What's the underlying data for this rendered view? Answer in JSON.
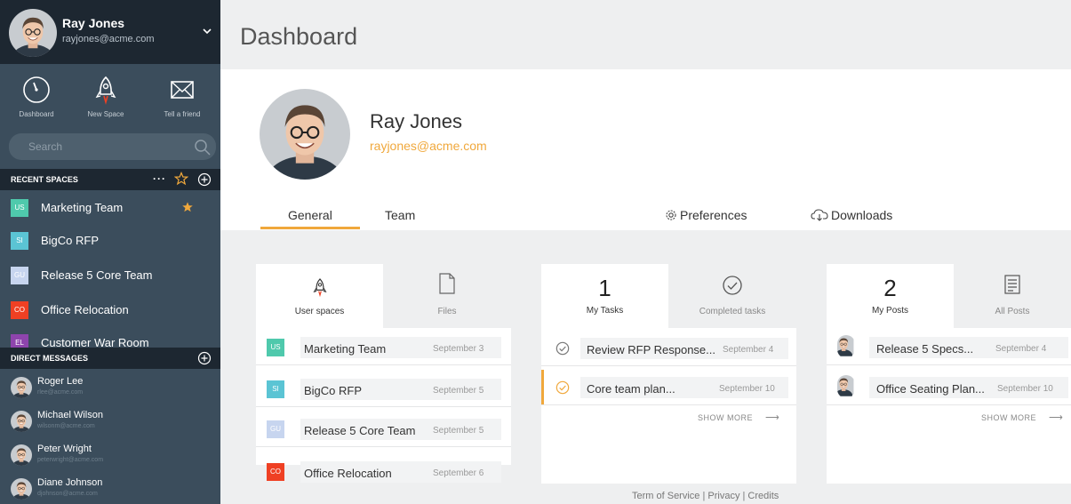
{
  "user": {
    "name": "Ray Jones",
    "email": "rayjones@acme.com"
  },
  "quick_actions": [
    {
      "label": "Dashboard",
      "icon": "dashboard-icon"
    },
    {
      "label": "New Space",
      "icon": "rocket-icon"
    },
    {
      "label": "Tell a friend",
      "icon": "envelope-icon"
    }
  ],
  "search": {
    "placeholder": "Search"
  },
  "recent_spaces": {
    "heading": "RECENT SPACES",
    "more": "···",
    "items": [
      {
        "badge": "US",
        "name": "Marketing Team",
        "color": "#4fc9ac",
        "starred": true
      },
      {
        "badge": "SI",
        "name": "BigCo RFP",
        "color": "#5bc4d4",
        "starred": false
      },
      {
        "badge": "GU",
        "name": "Release 5 Core Team",
        "color": "#c7d5ef",
        "starred": false
      },
      {
        "badge": "CO",
        "name": "Office Relocation",
        "color": "#ef4023",
        "starred": false
      },
      {
        "badge": "EL",
        "name": "Customer War Room",
        "color": "#8e44ad",
        "starred": false
      }
    ]
  },
  "direct_messages": {
    "heading": "DIRECT MESSAGES",
    "items": [
      {
        "name": "Roger Lee",
        "email": "rlee@acme.com"
      },
      {
        "name": "Michael Wilson",
        "email": "wilsonm@acme.com"
      },
      {
        "name": "Peter Wright",
        "email": "peterwright@acme.com"
      },
      {
        "name": "Diane Johnson",
        "email": "djohnson@acme.com"
      }
    ]
  },
  "page": {
    "title": "Dashboard"
  },
  "tabs": {
    "general": "General",
    "team": "Team",
    "preferences": "Preferences",
    "downloads": "Downloads"
  },
  "cards": {
    "spaces": {
      "tab_active": "User spaces",
      "tab_inactive": "Files",
      "items": [
        {
          "badge": "US",
          "name": "Marketing Team",
          "date": "September 3",
          "color": "#4fc9ac"
        },
        {
          "badge": "SI",
          "name": "BigCo RFP",
          "date": "September 5",
          "color": "#5bc4d4"
        },
        {
          "badge": "GU",
          "name": "Release 5 Core Team",
          "date": "September 5",
          "color": "#c7d5ef"
        },
        {
          "badge": "CO",
          "name": "Office Relocation",
          "date": "September 6",
          "color": "#ef4023"
        }
      ]
    },
    "tasks": {
      "count": "1",
      "tab_active": "My Tasks",
      "tab_inactive": "Completed tasks",
      "items": [
        {
          "name": "Review RFP Response...",
          "date": "September 4",
          "highlight": false
        },
        {
          "name": "Core team plan...",
          "date": "September 10",
          "highlight": true
        }
      ],
      "show_more": "SHOW MORE",
      "arrow": "⟶"
    },
    "posts": {
      "count": "2",
      "tab_active": "My Posts",
      "tab_inactive": "All Posts",
      "items": [
        {
          "name": "Release 5 Specs...",
          "date": "September 4"
        },
        {
          "name": "Office Seating Plan...",
          "date": "September 10"
        }
      ],
      "show_more": "SHOW MORE",
      "arrow": "⟶"
    }
  },
  "footer": {
    "text": "Term of Service | Privacy | Credits"
  },
  "colors": {
    "accent": "#f0a83c",
    "sidebar": "#3b4d5c",
    "sidebar_dark": "#1d2731"
  }
}
